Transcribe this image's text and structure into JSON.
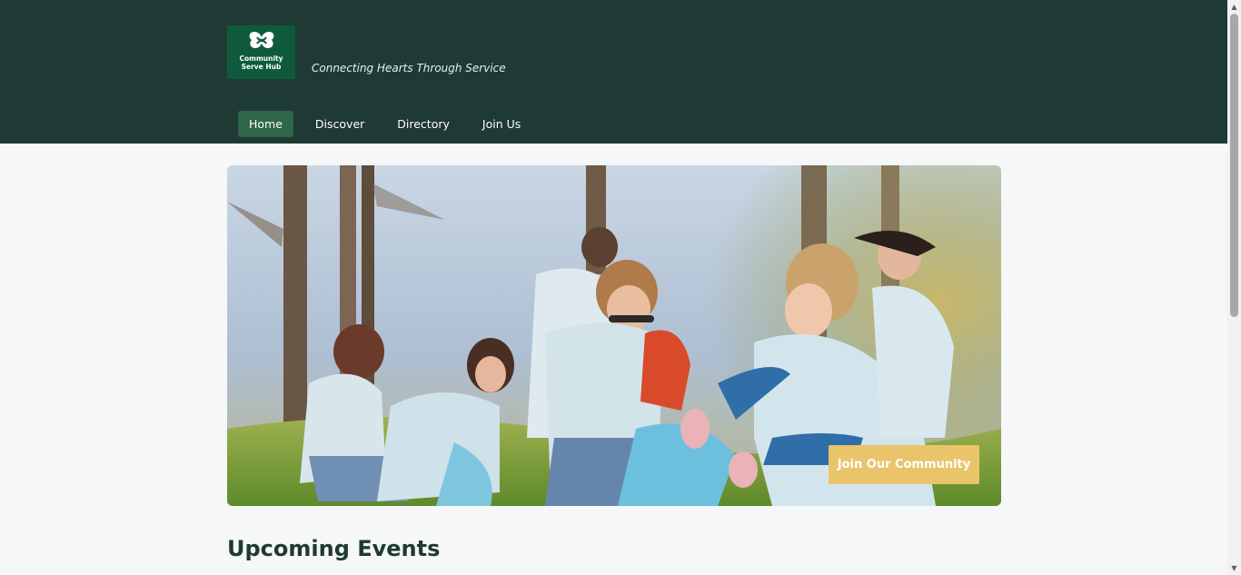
{
  "header": {
    "logo_line1": "Community",
    "logo_line2": "Serve Hub",
    "tagline": "Connecting Hearts Through Service"
  },
  "nav": {
    "items": [
      {
        "label": "Home",
        "active": true
      },
      {
        "label": "Discover",
        "active": false
      },
      {
        "label": "Directory",
        "active": false
      },
      {
        "label": "Join Us",
        "active": false
      }
    ]
  },
  "hero": {
    "cta_label": "Join Our Community"
  },
  "sections": {
    "upcoming_title": "Upcoming Events"
  },
  "colors": {
    "header_bg": "#1f3a34",
    "nav_active_bg": "#2f6548",
    "logo_bg": "#0f5a3c",
    "cta_bg": "#e9c46a",
    "title_color": "#1d3a33"
  },
  "icons": {
    "logo": "hands-heart-icon",
    "scroll_up": "scroll-up-arrow-icon",
    "scroll_down": "scroll-down-arrow-icon"
  }
}
